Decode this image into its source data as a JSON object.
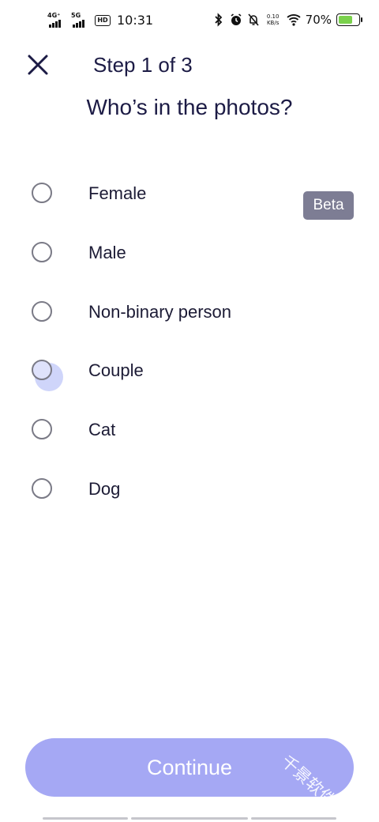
{
  "status_bar": {
    "network_1": "4G⁺",
    "network_2": "5G",
    "hd_badge": "HD",
    "time": "10:31",
    "speed_value": "0.10",
    "speed_unit": "KB/s",
    "battery_percent": "70%",
    "battery_level": 0.7
  },
  "header": {
    "step_label": "Step 1 of 3",
    "question": "Who’s in the photos?"
  },
  "options": [
    {
      "label": "Female",
      "selected": false
    },
    {
      "label": "Male",
      "selected": false
    },
    {
      "label": "Non-binary person",
      "selected": false
    },
    {
      "label": "Couple",
      "selected": false,
      "badge": "Beta",
      "pressed": true
    },
    {
      "label": "Cat",
      "selected": false
    },
    {
      "label": "Dog",
      "selected": false
    }
  ],
  "continue_label": "Continue",
  "watermark": "千景软件站",
  "colors": {
    "accent": "#a5a8f4",
    "title": "#1c1b45",
    "badge_bg": "#7d7d94",
    "battery": "#7ad14c"
  }
}
